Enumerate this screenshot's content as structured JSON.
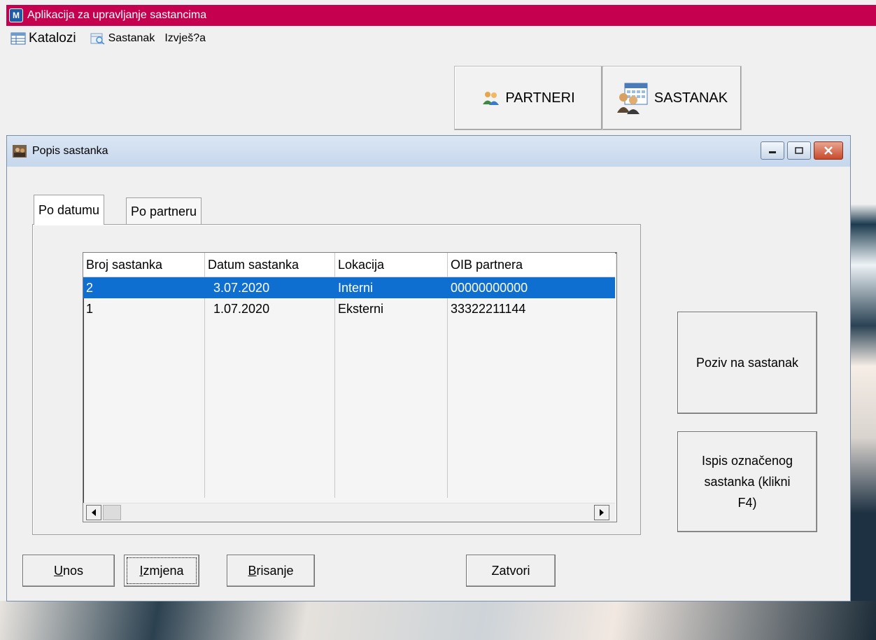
{
  "app": {
    "title": "Aplikacija za upravljanje sastancima"
  },
  "menu": {
    "items": [
      {
        "label": "Katalozi",
        "icon": "table-icon"
      },
      {
        "label": "Sastanak",
        "icon": "calendar-search-icon"
      },
      {
        "label": "Izvješ?a",
        "icon": ""
      }
    ]
  },
  "toolbar": {
    "partneri_label": "PARTNERI",
    "sastanak_label": "SASTANAK"
  },
  "child_window": {
    "title": "Popis sastanka",
    "tabs": [
      {
        "label": "Po datumu"
      },
      {
        "label": "Po partneru"
      }
    ]
  },
  "list": {
    "columns": [
      "Broj sastanka",
      "Datum sastanka",
      "Lokacija",
      "OIB partnera"
    ],
    "rows": [
      {
        "broj": "2",
        "datum": "3.07.2020",
        "lokacija": "Interni",
        "oib": "00000000000",
        "selected": true
      },
      {
        "broj": "1",
        "datum": "1.07.2020",
        "lokacija": "Eksterni",
        "oib": "33322211144",
        "selected": false
      }
    ]
  },
  "side_buttons": {
    "poziv": "Poziv na sastanak",
    "ispis_line1": "Ispis označenog",
    "ispis_line2": "sastanka (klikni",
    "ispis_line3": "F4)"
  },
  "bottom_buttons": {
    "unos_key": "U",
    "unos_rest": "nos",
    "izmjena_key": "I",
    "izmjena_rest": "zmjena",
    "brisanje_key": "B",
    "brisanje_rest": "risanje",
    "zatvori": "Zatvori"
  },
  "colors": {
    "titlebar": "#c4004f",
    "selection": "#0f6fd0",
    "child_title": "#c6d7ec"
  }
}
